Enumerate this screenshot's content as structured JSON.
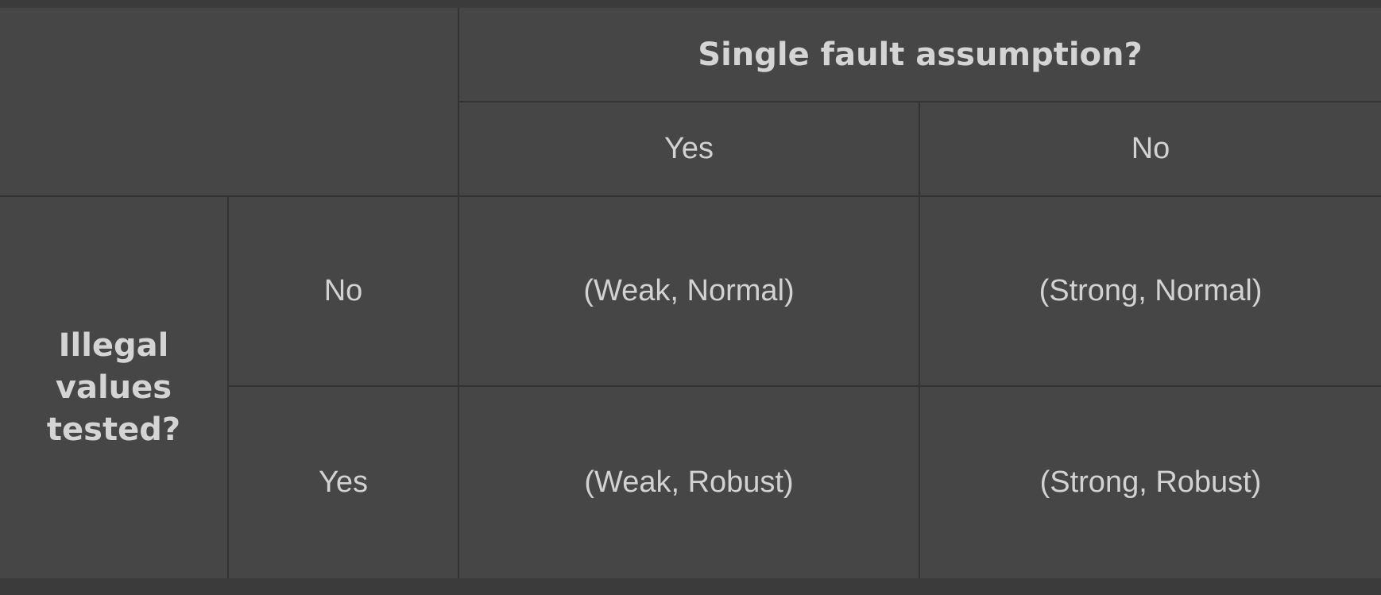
{
  "table": {
    "column_group_header": "Single fault assumption?",
    "column_headers": [
      "Yes",
      "No"
    ],
    "row_group_header": "Illegal\nvalues\ntested?",
    "row_headers": [
      "No",
      "Yes"
    ],
    "cells": [
      [
        "(Weak, Normal)",
        "(Strong, Normal)"
      ],
      [
        "(Weak, Robust)",
        "(Strong, Robust)"
      ]
    ]
  }
}
